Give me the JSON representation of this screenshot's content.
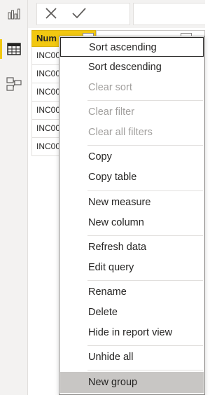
{
  "nav": {
    "items": [
      {
        "name": "report-view",
        "icon": "bar-chart-icon"
      },
      {
        "name": "data-view",
        "icon": "table-grid-icon",
        "active": true
      },
      {
        "name": "model-view",
        "icon": "model-diagram-icon"
      }
    ]
  },
  "formula_bar": {
    "cancel_icon": "close-icon",
    "commit_icon": "check-icon",
    "value": ""
  },
  "table": {
    "columns": [
      {
        "label": "Num",
        "selected": true
      },
      {
        "label": "",
        "selected": false
      }
    ],
    "rows": [
      "INC00",
      "INC00",
      "INC00",
      "INC00",
      "INC00",
      "INC00"
    ]
  },
  "context_menu": {
    "items": [
      {
        "label": "Sort ascending",
        "enabled": true,
        "focused": true
      },
      {
        "label": "Sort descending",
        "enabled": true
      },
      {
        "label": "Clear sort",
        "enabled": false
      },
      {
        "label": "Clear filter",
        "enabled": false
      },
      {
        "label": "Clear all filters",
        "enabled": false
      },
      {
        "label": "Copy",
        "enabled": true
      },
      {
        "label": "Copy table",
        "enabled": true
      },
      {
        "label": "New measure",
        "enabled": true
      },
      {
        "label": "New column",
        "enabled": true
      },
      {
        "label": "Refresh data",
        "enabled": true
      },
      {
        "label": "Edit query",
        "enabled": true
      },
      {
        "label": "Rename",
        "enabled": true
      },
      {
        "label": "Delete",
        "enabled": true
      },
      {
        "label": "Hide in report view",
        "enabled": true
      },
      {
        "label": "Unhide all",
        "enabled": true
      },
      {
        "label": "New group",
        "enabled": true,
        "hovered": true
      }
    ]
  },
  "colors": {
    "accent": "#f2c811",
    "menu_hover": "#c8c6c4",
    "disabled_text": "#a19f9d"
  }
}
